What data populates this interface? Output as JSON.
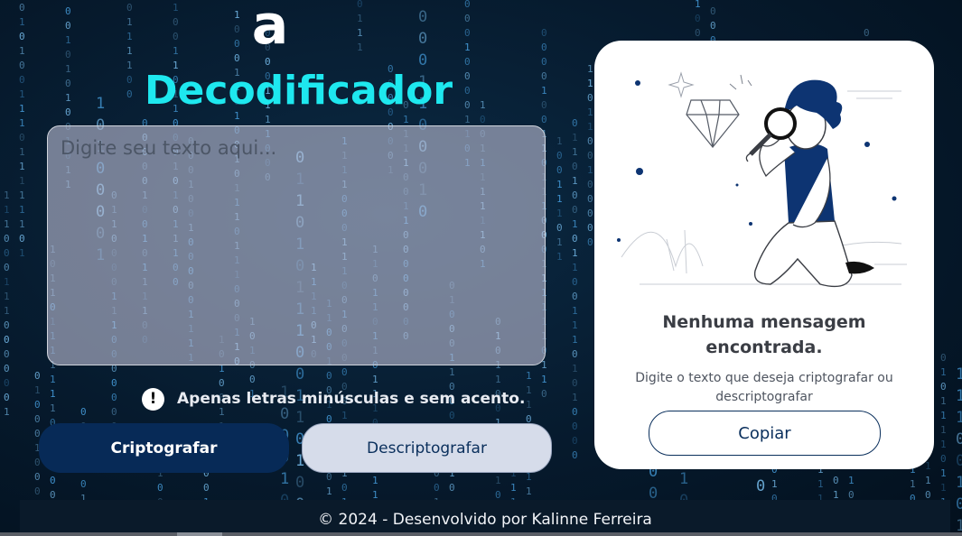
{
  "app": {
    "logo_letter": "a",
    "title": "Decodificador"
  },
  "input": {
    "placeholder": "Digite seu texto aqui...",
    "value": ""
  },
  "hint": {
    "icon": "exclamation-icon",
    "icon_glyph": "!",
    "text": "Apenas letras minúsculas e sem acento."
  },
  "buttons": {
    "encrypt_label": "Criptografar",
    "decrypt_label": "Descriptografar"
  },
  "output_card": {
    "illustration": "person-with-magnifying-glass",
    "title": "Nenhuma mensagem encontrada.",
    "subtitle": "Digite o texto que deseja criptografar ou descriptografar",
    "copy_label": "Copiar"
  },
  "footer": {
    "text": "© 2024 - Desenvolvido por Kalinne Ferreira"
  },
  "colors": {
    "accent": "#1ee8ef",
    "primary_button": "#072a57",
    "secondary_button": "#d6dcea",
    "background": "#061a2d",
    "card": "#ffffff"
  }
}
